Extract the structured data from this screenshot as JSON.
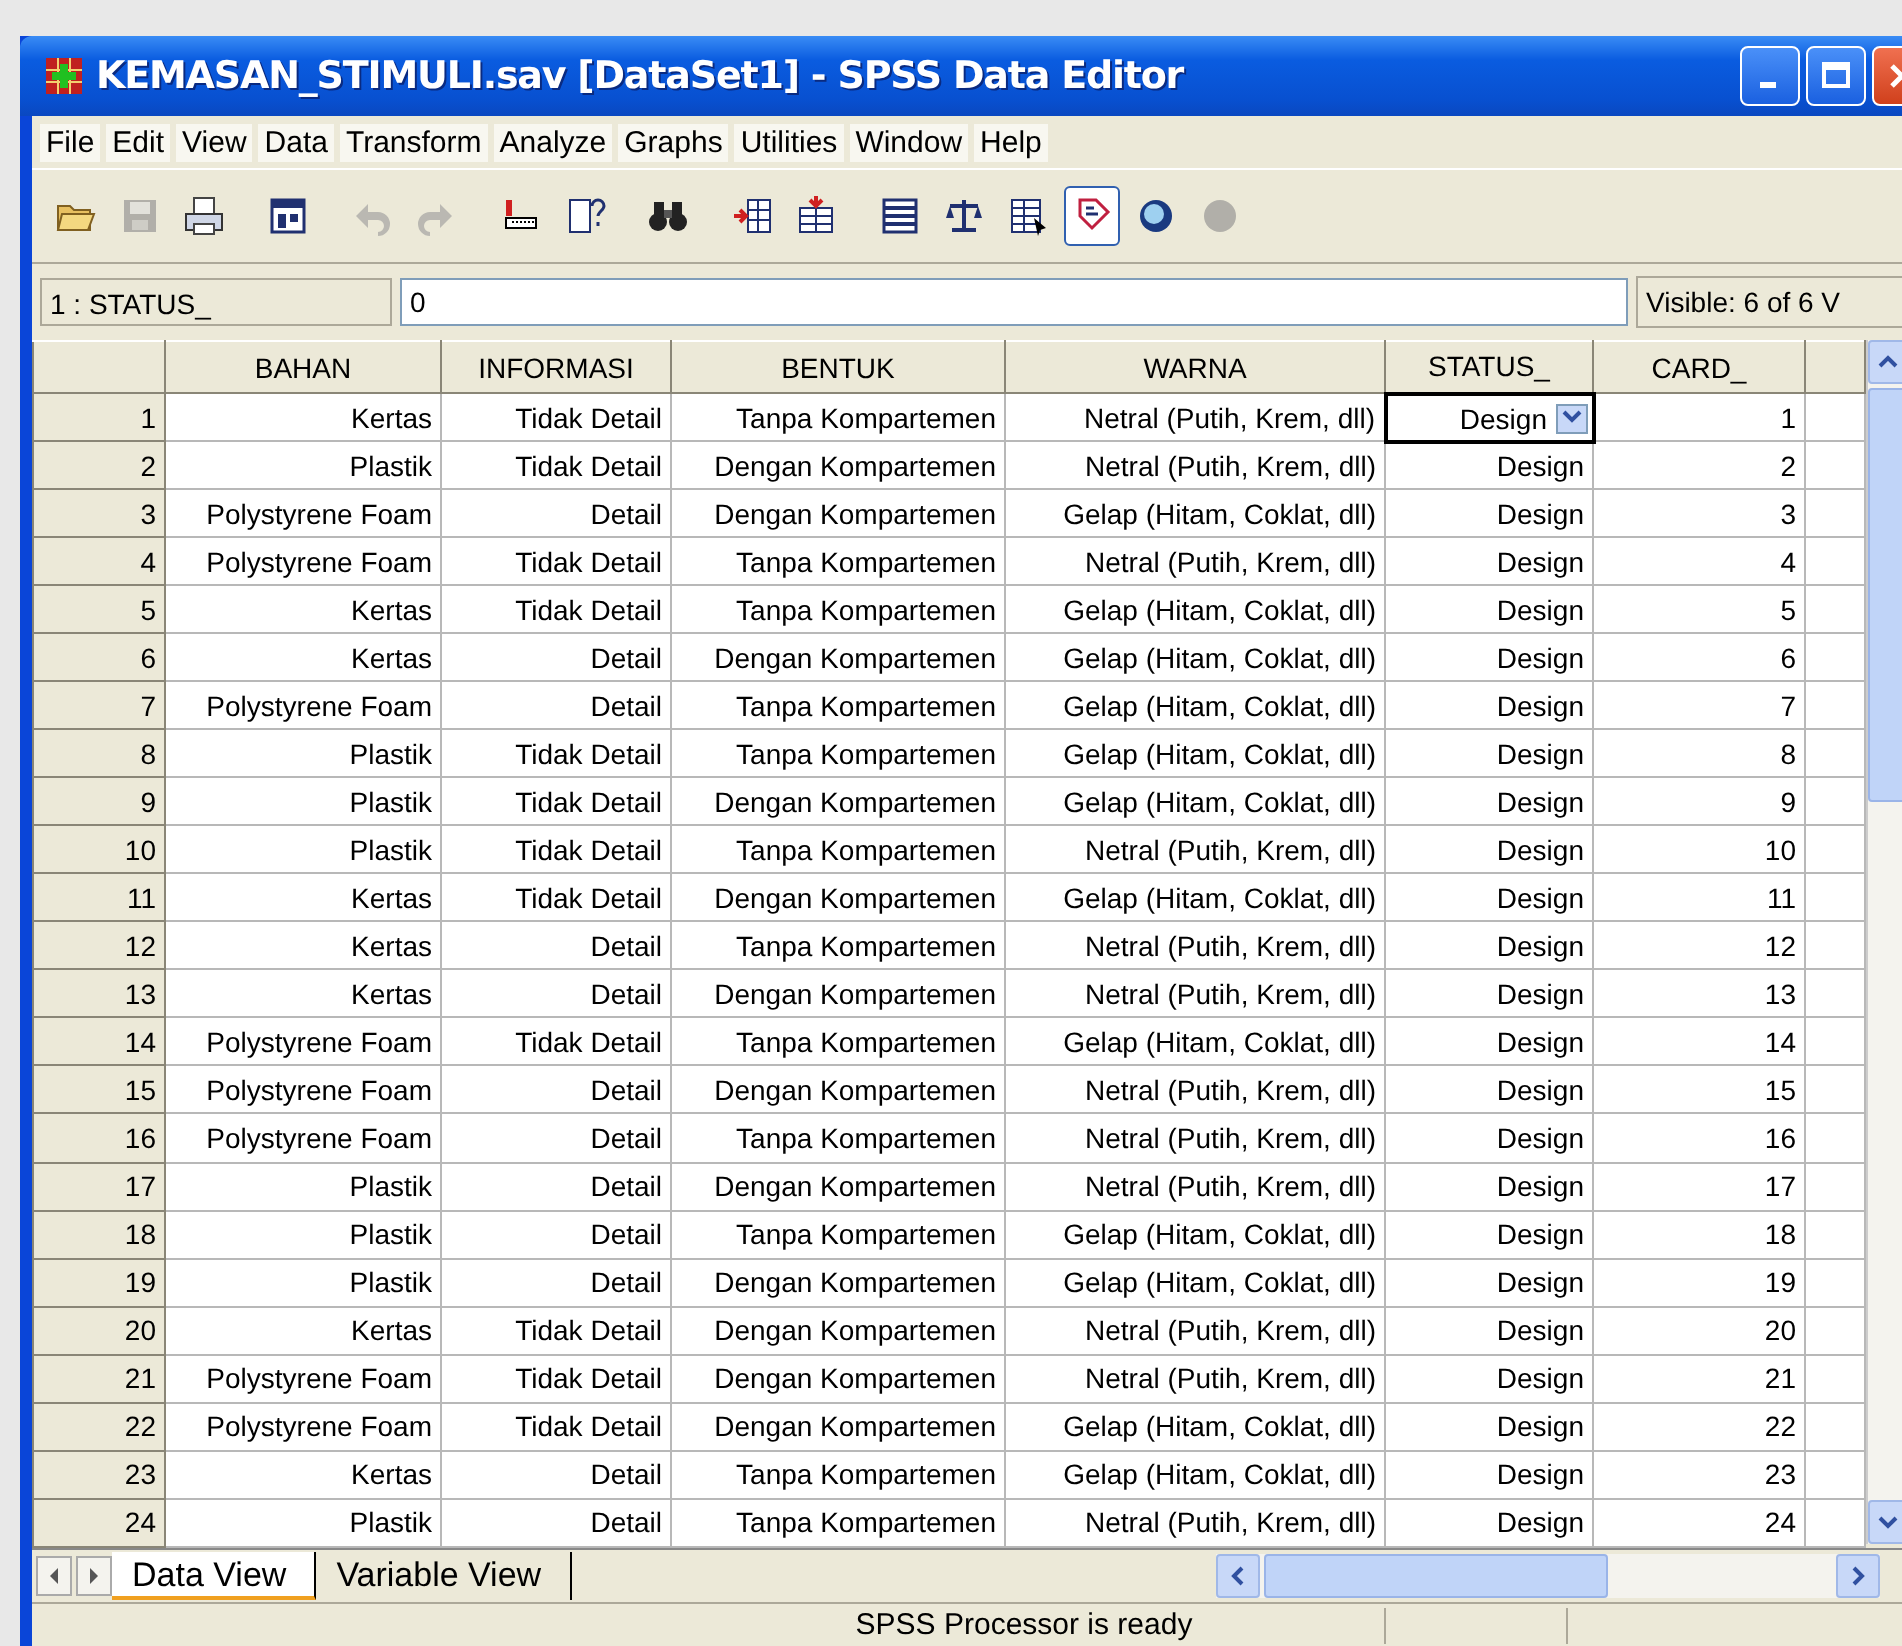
{
  "window": {
    "title": "KEMASAN_STIMULI.sav [DataSet1] - SPSS Data Editor"
  },
  "menu": [
    "File",
    "Edit",
    "View",
    "Data",
    "Transform",
    "Analyze",
    "Graphs",
    "Utilities",
    "Window",
    "Help"
  ],
  "toolbar": [
    {
      "kind": "open",
      "disabled": false,
      "pressed": false
    },
    {
      "kind": "save",
      "disabled": true,
      "pressed": false
    },
    {
      "kind": "print",
      "disabled": false,
      "pressed": false
    },
    {
      "kind": "dialog",
      "disabled": false,
      "pressed": false
    },
    {
      "kind": "undo",
      "disabled": true,
      "pressed": false
    },
    {
      "kind": "redo",
      "disabled": true,
      "pressed": false
    },
    {
      "kind": "goto",
      "disabled": false,
      "pressed": false
    },
    {
      "kind": "variables",
      "disabled": false,
      "pressed": false
    },
    {
      "kind": "find",
      "disabled": false,
      "pressed": false
    },
    {
      "kind": "insert_case",
      "disabled": false,
      "pressed": false
    },
    {
      "kind": "insert_variable",
      "disabled": false,
      "pressed": false
    },
    {
      "kind": "split",
      "disabled": false,
      "pressed": false
    },
    {
      "kind": "weight",
      "disabled": false,
      "pressed": false
    },
    {
      "kind": "select",
      "disabled": false,
      "pressed": false
    },
    {
      "kind": "value_labels",
      "disabled": false,
      "pressed": true
    },
    {
      "kind": "sets",
      "disabled": false,
      "pressed": false
    },
    {
      "kind": "show_sets",
      "disabled": true,
      "pressed": false
    }
  ],
  "cell_editor": {
    "cell": "1 : STATUS_",
    "value": "0",
    "visible": "Visible: 6 of 6 V"
  },
  "table": {
    "columns": [
      "BAHAN",
      "INFORMASI",
      "BENTUK",
      "WARNA",
      "STATUS_",
      "CARD_"
    ],
    "rows": [
      {
        "number": "1",
        "selected": true,
        "cells": [
          "Kertas",
          "Tidak Detail",
          "Tanpa Kompartemen",
          "Netral (Putih, Krem, dll)",
          "Design",
          "1"
        ]
      },
      {
        "number": "2",
        "selected": false,
        "cells": [
          "Plastik",
          "Tidak Detail",
          "Dengan Kompartemen",
          "Netral (Putih, Krem, dll)",
          "Design",
          "2"
        ]
      },
      {
        "number": "3",
        "selected": false,
        "cells": [
          "Polystyrene Foam",
          "Detail",
          "Dengan Kompartemen",
          "Gelap (Hitam, Coklat, dll)",
          "Design",
          "3"
        ]
      },
      {
        "number": "4",
        "selected": false,
        "cells": [
          "Polystyrene Foam",
          "Tidak Detail",
          "Tanpa Kompartemen",
          "Netral (Putih, Krem, dll)",
          "Design",
          "4"
        ]
      },
      {
        "number": "5",
        "selected": false,
        "cells": [
          "Kertas",
          "Tidak Detail",
          "Tanpa Kompartemen",
          "Gelap (Hitam, Coklat, dll)",
          "Design",
          "5"
        ]
      },
      {
        "number": "6",
        "selected": false,
        "cells": [
          "Kertas",
          "Detail",
          "Dengan Kompartemen",
          "Gelap (Hitam, Coklat, dll)",
          "Design",
          "6"
        ]
      },
      {
        "number": "7",
        "selected": false,
        "cells": [
          "Polystyrene Foam",
          "Detail",
          "Tanpa Kompartemen",
          "Gelap (Hitam, Coklat, dll)",
          "Design",
          "7"
        ]
      },
      {
        "number": "8",
        "selected": false,
        "cells": [
          "Plastik",
          "Tidak Detail",
          "Tanpa Kompartemen",
          "Gelap (Hitam, Coklat, dll)",
          "Design",
          "8"
        ]
      },
      {
        "number": "9",
        "selected": false,
        "cells": [
          "Plastik",
          "Tidak Detail",
          "Dengan Kompartemen",
          "Gelap (Hitam, Coklat, dll)",
          "Design",
          "9"
        ]
      },
      {
        "number": "10",
        "selected": false,
        "cells": [
          "Plastik",
          "Tidak Detail",
          "Tanpa Kompartemen",
          "Netral (Putih, Krem, dll)",
          "Design",
          "10"
        ]
      },
      {
        "number": "11",
        "selected": false,
        "cells": [
          "Kertas",
          "Tidak Detail",
          "Dengan Kompartemen",
          "Gelap (Hitam, Coklat, dll)",
          "Design",
          "11"
        ]
      },
      {
        "number": "12",
        "selected": false,
        "cells": [
          "Kertas",
          "Detail",
          "Tanpa Kompartemen",
          "Netral (Putih, Krem, dll)",
          "Design",
          "12"
        ]
      },
      {
        "number": "13",
        "selected": false,
        "cells": [
          "Kertas",
          "Detail",
          "Dengan Kompartemen",
          "Netral (Putih, Krem, dll)",
          "Design",
          "13"
        ]
      },
      {
        "number": "14",
        "selected": false,
        "cells": [
          "Polystyrene Foam",
          "Tidak Detail",
          "Tanpa Kompartemen",
          "Gelap (Hitam, Coklat, dll)",
          "Design",
          "14"
        ]
      },
      {
        "number": "15",
        "selected": false,
        "cells": [
          "Polystyrene Foam",
          "Detail",
          "Dengan Kompartemen",
          "Netral (Putih, Krem, dll)",
          "Design",
          "15"
        ]
      },
      {
        "number": "16",
        "selected": false,
        "cells": [
          "Polystyrene Foam",
          "Detail",
          "Tanpa Kompartemen",
          "Netral (Putih, Krem, dll)",
          "Design",
          "16"
        ]
      },
      {
        "number": "17",
        "selected": false,
        "cells": [
          "Plastik",
          "Detail",
          "Dengan Kompartemen",
          "Netral (Putih, Krem, dll)",
          "Design",
          "17"
        ]
      },
      {
        "number": "18",
        "selected": false,
        "cells": [
          "Plastik",
          "Detail",
          "Tanpa Kompartemen",
          "Gelap (Hitam, Coklat, dll)",
          "Design",
          "18"
        ]
      },
      {
        "number": "19",
        "selected": false,
        "cells": [
          "Plastik",
          "Detail",
          "Dengan Kompartemen",
          "Gelap (Hitam, Coklat, dll)",
          "Design",
          "19"
        ]
      },
      {
        "number": "20",
        "selected": false,
        "cells": [
          "Kertas",
          "Tidak Detail",
          "Dengan Kompartemen",
          "Netral (Putih, Krem, dll)",
          "Design",
          "20"
        ]
      },
      {
        "number": "21",
        "selected": false,
        "cells": [
          "Polystyrene Foam",
          "Tidak Detail",
          "Dengan Kompartemen",
          "Netral (Putih, Krem, dll)",
          "Design",
          "21"
        ]
      },
      {
        "number": "22",
        "selected": false,
        "cells": [
          "Polystyrene Foam",
          "Tidak Detail",
          "Dengan Kompartemen",
          "Gelap (Hitam, Coklat, dll)",
          "Design",
          "22"
        ]
      },
      {
        "number": "23",
        "selected": false,
        "cells": [
          "Kertas",
          "Detail",
          "Tanpa Kompartemen",
          "Gelap (Hitam, Coklat, dll)",
          "Design",
          "23"
        ]
      },
      {
        "number": "24",
        "selected": false,
        "cells": [
          "Plastik",
          "Detail",
          "Tanpa Kompartemen",
          "Netral (Putih, Krem, dll)",
          "Design",
          "24"
        ]
      }
    ]
  },
  "tabs": [
    {
      "label": "Data View",
      "selected": true
    },
    {
      "label": "Variable View",
      "selected": false
    }
  ],
  "status_bar": {
    "text": "SPSS Processor is ready"
  }
}
